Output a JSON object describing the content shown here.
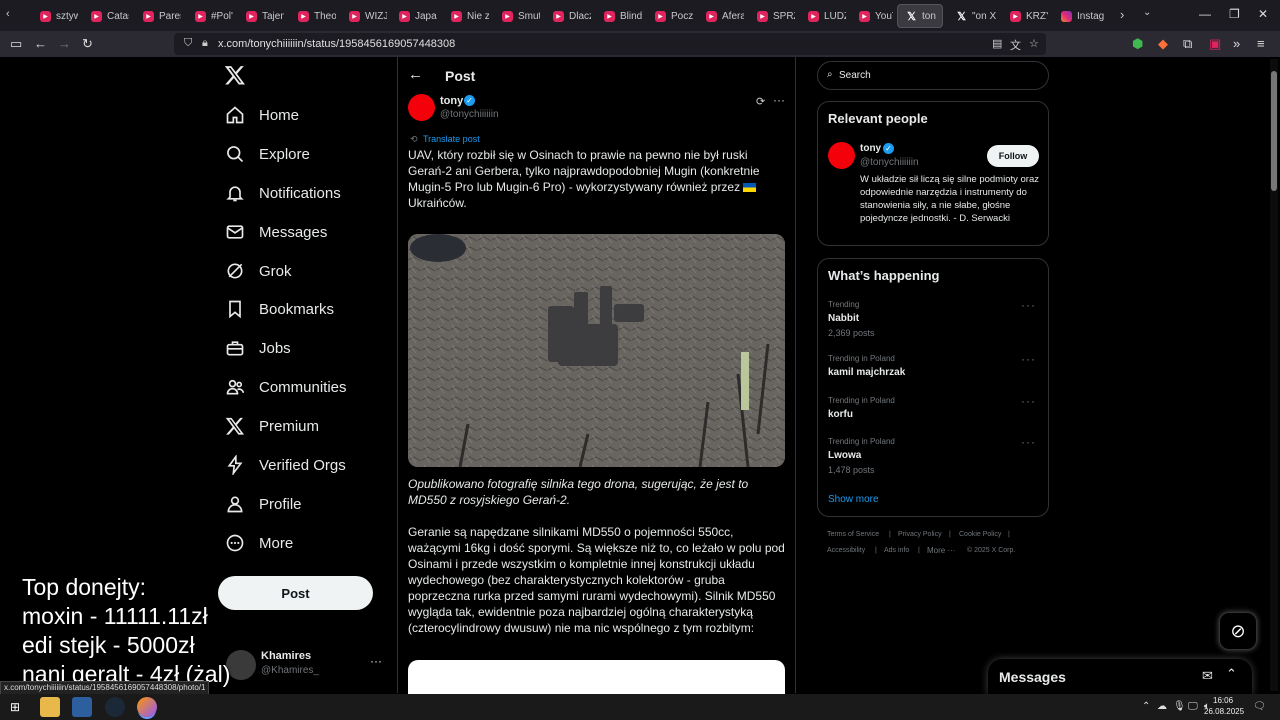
{
  "browser": {
    "tabs": [
      {
        "label": "sztyw",
        "icon": "youtube-icon"
      },
      {
        "label": "Catast",
        "icon": "youtube-icon"
      },
      {
        "label": "Paren",
        "icon": "youtube-icon"
      },
      {
        "label": "#Pol'a",
        "icon": "youtube-icon"
      },
      {
        "label": "Tajem",
        "icon": "youtube-icon"
      },
      {
        "label": "Theoc",
        "icon": "youtube-icon"
      },
      {
        "label": "WIZJO",
        "icon": "youtube-icon"
      },
      {
        "label": "Japan",
        "icon": "youtube-icon"
      },
      {
        "label": "Nie zr",
        "icon": "youtube-icon"
      },
      {
        "label": "Smutr",
        "icon": "youtube-icon"
      },
      {
        "label": "Dlacz",
        "icon": "youtube-icon"
      },
      {
        "label": "Blind I",
        "icon": "youtube-icon"
      },
      {
        "label": "Począ",
        "icon": "youtube-icon"
      },
      {
        "label": "Afera",
        "icon": "youtube-icon"
      },
      {
        "label": "SPRZA",
        "icon": "youtube-icon"
      },
      {
        "label": "LUDZI",
        "icon": "youtube-icon"
      },
      {
        "label": "YouTu",
        "icon": "youtube-icon"
      },
      {
        "label": "ton",
        "icon": "x-logo-icon",
        "active": true
      },
      {
        "label": "\"on X",
        "icon": "x-logo-icon"
      },
      {
        "label": "KRZY",
        "icon": "youtube-icon"
      },
      {
        "label": "Instag",
        "icon": "instagram-icon"
      }
    ],
    "url": "x.com/tonychiiiiiin/status/1958456169057448308",
    "status_url": "x.com/tonychiiiiiin/status/1958456169057448308/photo/1"
  },
  "sidebar": {
    "logo": "x-logo-icon",
    "items": [
      {
        "label": "Home",
        "icon": "home-icon"
      },
      {
        "label": "Explore",
        "icon": "search-icon"
      },
      {
        "label": "Notifications",
        "icon": "bell-icon"
      },
      {
        "label": "Messages",
        "icon": "envelope-icon"
      },
      {
        "label": "Grok",
        "icon": "grok-icon"
      },
      {
        "label": "Bookmarks",
        "icon": "bookmark-icon"
      },
      {
        "label": "Jobs",
        "icon": "briefcase-icon"
      },
      {
        "label": "Communities",
        "icon": "people-icon"
      },
      {
        "label": "Premium",
        "icon": "x-logo-icon"
      },
      {
        "label": "Verified Orgs",
        "icon": "lightning-icon"
      },
      {
        "label": "Profile",
        "icon": "person-icon"
      },
      {
        "label": "More",
        "icon": "more-circle-icon"
      }
    ],
    "post_label": "Post",
    "account": {
      "name": "Khamires",
      "handle": "@Khamires_"
    }
  },
  "post": {
    "header_title": "Post",
    "author_name": "tony",
    "author_handle": "@tonychiiiiiin",
    "translate_label": "Translate post",
    "text_1": "UAV, który rozbił się w Osinach to prawie na pewno nie był ruski Gerań-2 ani Gerbera, tylko najprawdopodobniej Mugin (konkretnie Mugin-5 Pro lub Mugin-6 Pro) - wykorzystywany również przez",
    "text_1_end": "Ukraińców.",
    "caption": "Opublikowano fotografię silnika tego drona, sugerując, że jest to MD550 z rosyjskiego Gerań-2.",
    "text_2": "Geranie są napędzane silnikami MD550 o pojemności 550cc, ważącymi 16kg i dość sporymi. Są większe niż to, co leżało w polu pod Osinami i przede wszystkim o kompletnie innej konstrukcji układu wydechowego (bez charakterystycznych kolektorów - gruba poprzeczna rurka przed samymi rurami wydechowymi). Silnik MD550 wygląda tak, ewidentnie poza najbardziej ogólną charakterystyką (czterocylindrowy dwusuw) nie ma nic wspólnego z tym rozbitym:"
  },
  "right": {
    "search_placeholder": "Search",
    "relevant_title": "Relevant people",
    "person": {
      "name": "tony",
      "handle": "@tonychiiiiiin",
      "follow_label": "Follow",
      "bio": "W układzie sił liczą się silne podmioty oraz odpowiednie narzędzia i instrumenty do stanowienia siły, a nie słabe, głośne pojedyncze jednostki. - D. Serwacki"
    },
    "happening_title": "What’s happening",
    "trends": [
      {
        "meta": "Trending",
        "name": "Nabbit",
        "count": "2,369 posts"
      },
      {
        "meta": "Trending in Poland",
        "name": "kamil majchrzak",
        "count": ""
      },
      {
        "meta": "Trending in Poland",
        "name": "korfu",
        "count": ""
      },
      {
        "meta": "Trending in Poland",
        "name": "Lwowa",
        "count": "1,478 posts"
      }
    ],
    "show_more": "Show more",
    "footer": {
      "terms": "Terms of Service",
      "privacy": "Privacy Policy",
      "cookie": "Cookie Policy",
      "accessibility": "Accessibility",
      "ads": "Ads info",
      "more": "More ···",
      "copyright": "© 2025 X Corp."
    },
    "messages_label": "Messages"
  },
  "overlay": {
    "line1": "Top donejty:",
    "line2": "moxin - 11111.11zł",
    "line3": "edi stejk - 5000zł",
    "line4": "nani geralt - 4zł (żal)"
  },
  "taskbar": {
    "time": "16:06",
    "date": "26.08.2025"
  },
  "colors": {
    "accent": "#1d9bf0",
    "background": "#000000",
    "border": "#2f3336",
    "muted": "#71767b"
  }
}
